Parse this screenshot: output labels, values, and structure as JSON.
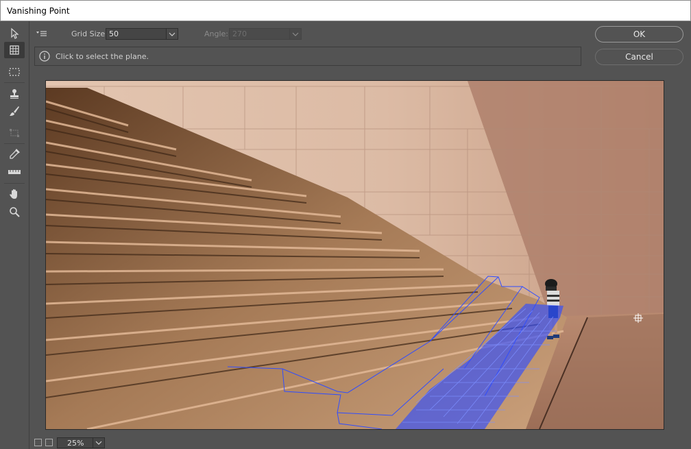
{
  "window": {
    "title": "Vanishing Point"
  },
  "tools": [
    {
      "name": "edit-plane-tool",
      "icon": "arrow-pointer-icon"
    },
    {
      "name": "create-plane-tool",
      "icon": "grid-plane-icon",
      "active": true
    },
    {
      "name": "marquee-tool",
      "icon": "dashed-rect-icon"
    },
    {
      "name": "stamp-tool",
      "icon": "stamp-icon"
    },
    {
      "name": "brush-tool",
      "icon": "brush-icon"
    },
    {
      "name": "transform-tool",
      "icon": "transform-icon"
    },
    {
      "name": "eyedropper-tool",
      "icon": "eyedropper-icon"
    },
    {
      "name": "measure-tool",
      "icon": "ruler-icon"
    },
    {
      "name": "hand-tool",
      "icon": "hand-icon"
    },
    {
      "name": "zoom-tool",
      "icon": "magnifier-icon"
    }
  ],
  "options": {
    "grid_size_label": "Grid Size:",
    "grid_size_value": "50",
    "angle_label": "Angle:",
    "angle_value": "270"
  },
  "info": {
    "message": "Click to select the plane."
  },
  "buttons": {
    "ok": "OK",
    "cancel": "Cancel"
  },
  "status": {
    "zoom": "25%"
  },
  "colors": {
    "grid": "#2f4dff",
    "background": "#535353",
    "titlebar": "#ffffff"
  }
}
